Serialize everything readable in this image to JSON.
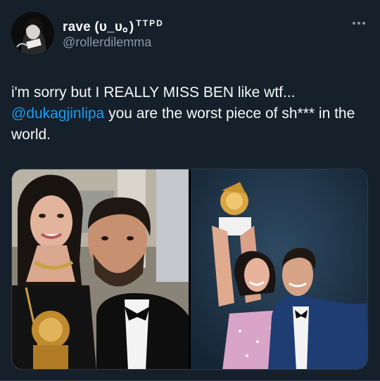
{
  "author": {
    "display_name": "rave (υ_υ。)",
    "name_suffix": "TTPD",
    "handle": "@rollerdilemma"
  },
  "tweet": {
    "text_before": "i'm sorry but I REALLY MISS BEN like wtf... ",
    "mention": "@dukagjinlipa",
    "text_after": " you are the worst piece of sh*** in the world."
  },
  "icons": {
    "more": "more-horizontal-icon"
  },
  "colors": {
    "background": "#15202b",
    "text": "#f7f9f9",
    "secondary": "#8b98a5",
    "link": "#1d9bf0"
  }
}
